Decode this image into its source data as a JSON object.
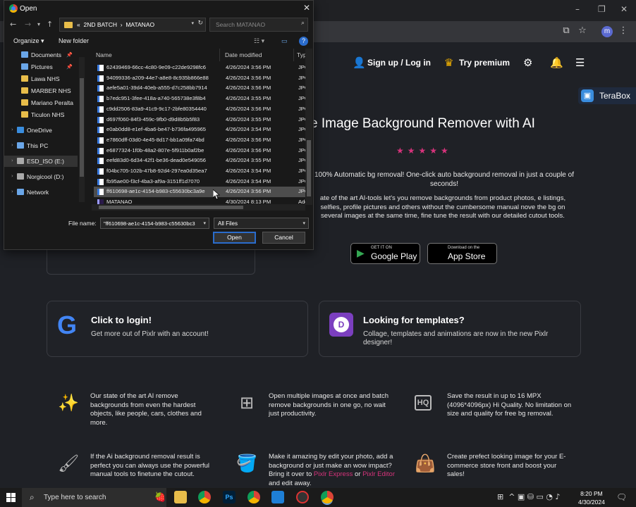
{
  "browser": {
    "window_controls": [
      "–",
      "❐",
      "✕"
    ],
    "profile_initial": "m"
  },
  "site": {
    "header": {
      "signup": "Sign up / Log in",
      "premium": "Try premium"
    },
    "terabox": "TeraBox",
    "hero_title": "e Image Background Remover with AI",
    "stars": "★★★★★",
    "hero_sub": "100% Automatic bg removal! One-click auto background removal in just a couple of seconds!",
    "hero_desc": "ate of the art AI-tools let's you remove backgrounds from product photos, e listings, selfies, profile pictures and others without the cumbersome manual nove the bg on several images at the same time, fine tune the result with our detailed cutout tools.",
    "google_play": {
      "small": "GET IT ON",
      "big": "Google Play"
    },
    "app_store": {
      "small": "Download on the",
      "big": "App Store"
    },
    "login_card": {
      "title": "Click to login!",
      "text": "Get more out of Pixlr with an account!"
    },
    "templates_card": {
      "title": "Looking for templates?",
      "text": "Collage, templates and animations are now in the new Pixlr designer!"
    },
    "features": [
      "Our state of the art AI remove backgrounds from even the hardest objects, like people, cars, clothes and more.",
      "Open multiple images at once and batch remove backgrounds in one go, no wait just productivity.",
      "Save the result in up to 16 MPX (4096*4096px) Hi Quality. No limitation on size and quality for free bg removal.",
      "If the Ai background removal result is perfect you can always use the powerful manual tools to finetune the cutout.",
      "Create prefect looking image for your E-commerce store front and boost your sales!"
    ],
    "feature_edit": {
      "before": "Make it amazing by edit your photo, add a background or just make an wow impact? Bring it over to",
      "link1": "Pixlr Express",
      "or": "or",
      "link2": "Pixlr Editor",
      "after": "and edit away."
    },
    "hq_icon": "HQ"
  },
  "dialog": {
    "title": "Open",
    "breadcrumb": [
      "«",
      "2ND BATCH",
      "›",
      "MATANAO"
    ],
    "search_placeholder": "Search MATANAO",
    "organize": "Organize ▾",
    "new_folder": "New folder",
    "nav_items": [
      {
        "label": "Documents",
        "pinned": true,
        "color": "#6aa6e8"
      },
      {
        "label": "Pictures",
        "pinned": true,
        "color": "#6aa6e8"
      },
      {
        "label": "Lawa NHS",
        "pinned": false,
        "color": "#e8bd4a"
      },
      {
        "label": "MARBER NHS",
        "pinned": false,
        "color": "#e8bd4a"
      },
      {
        "label": "Mariano Peralta",
        "pinned": false,
        "color": "#e8bd4a"
      },
      {
        "label": "Ticulon NHS",
        "pinned": false,
        "color": "#e8bd4a"
      },
      {
        "label": "OneDrive",
        "pinned": false,
        "color": "#3a8dde"
      },
      {
        "label": "This PC",
        "pinned": false,
        "color": "#6aa6e8"
      },
      {
        "label": "ESD_ISO (E:)",
        "pinned": false,
        "color": "#aaaaaa"
      },
      {
        "label": "Norgicool (D:)",
        "pinned": false,
        "color": "#aaaaaa"
      },
      {
        "label": "Network",
        "pinned": false,
        "color": "#6aa6e8"
      }
    ],
    "columns": {
      "name": "Name",
      "date": "Date modified",
      "type": "Type"
    },
    "files": [
      {
        "name": "62439469-66cc-4c80-9e09-c22de9298fc6",
        "date": "4/26/2024 3:56 PM",
        "type": "JPG F"
      },
      {
        "name": "94099336-a209-44e7-a8e8-8c935b866e88",
        "date": "4/26/2024 3:56 PM",
        "type": "JPG F"
      },
      {
        "name": "aefe5a01-39d4-40eb-a555-d7c258bb7914",
        "date": "4/26/2024 3:56 PM",
        "type": "JPG F"
      },
      {
        "name": "b7edc951-3fee-418a-a740-565738e3f8b4",
        "date": "4/26/2024 3:55 PM",
        "type": "JPG F"
      },
      {
        "name": "c9dd2506-83a9-41c9-9c17-2bfe80354440",
        "date": "4/26/2024 3:56 PM",
        "type": "JPG F"
      },
      {
        "name": "d697f060-84f3-459c-9fb0-d9d8b5b5f83",
        "date": "4/26/2024 3:55 PM",
        "type": "JPG F"
      },
      {
        "name": "e0ab0dd8-e1ef-4ba6-be47-b736fa495965",
        "date": "4/26/2024 3:54 PM",
        "type": "JPG F"
      },
      {
        "name": "e7860dff-03d0-4e45-8d17-bb1a09fa74bd",
        "date": "4/26/2024 3:56 PM",
        "type": "JPG F"
      },
      {
        "name": "e6877324-1f0b-48a2-807e-5f911b0af2be",
        "date": "4/26/2024 3:56 PM",
        "type": "JPG F"
      },
      {
        "name": "eefd83d0-6d34-42f1-be36-dead0e549056",
        "date": "4/26/2024 3:55 PM",
        "type": "JPG F"
      },
      {
        "name": "f04bc705-102b-47b8-92d4-297ea0d35ea7",
        "date": "4/26/2024 3:54 PM",
        "type": "JPG F"
      },
      {
        "name": "fb95ae00-f3cf-4ba3-af9a-3151ff1d7070",
        "date": "4/26/2024 3:54 PM",
        "type": "JPG F"
      },
      {
        "name": "ff610698-ae1c-4154-b983-c55630bc3a9e",
        "date": "4/26/2024 3:56 PM",
        "type": "JPG F",
        "selected": true
      },
      {
        "name": "MATANAO",
        "date": "4/30/2024 8:13 PM",
        "type": "Adob"
      }
    ],
    "file_name_label": "File name:",
    "file_name_value": "\"ff610698-ae1c-4154-b983-c55630bc3",
    "file_type_value": "All Files",
    "open_label": "Open",
    "cancel_label": "Cancel"
  },
  "taskbar": {
    "search_placeholder": "Type here to search",
    "time": "8:20 PM",
    "date": "4/30/2024"
  }
}
